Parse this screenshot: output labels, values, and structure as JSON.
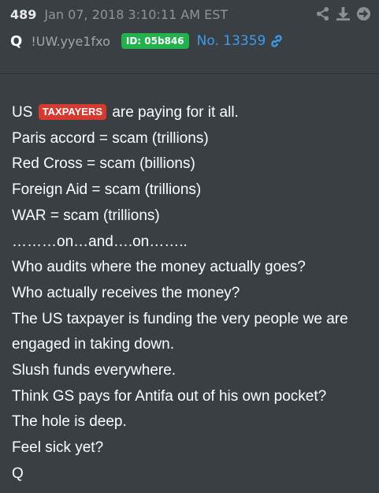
{
  "header": {
    "post_number": "489",
    "timestamp": "Jan 07, 2018 3:10:11 AM EST",
    "author": "Q",
    "tripcode": "!UW.yye1fxo",
    "id_badge": "ID: 05b846",
    "post_ref": "No. 13359",
    "icons": [
      "share-icon",
      "download-icon",
      "arrow-right-circle-icon",
      "link-icon"
    ],
    "id_badge_color": "#22b14c",
    "post_ref_color": "#3f9bea"
  },
  "body": {
    "line1_prefix": "US",
    "tag": "TAXPAYERS",
    "tag_color": "#d63a2f",
    "line1_suffix": "are paying for it all.",
    "lines": [
      "Paris accord = scam (trillions)",
      "Red Cross = scam (billions)",
      "Foreign Aid = scam (trillions)",
      "WAR = scam (trillions)",
      "………on…and….on……..",
      "Who audits where the money actually goes?",
      "Who actually receives the money?",
      "The US taxpayer is funding the very people we are",
      "engaged in taking down.",
      "Slush funds everywhere.",
      "Think GS pays for Antifa out of his own pocket?",
      "The hole is deep.",
      "Feel sick yet?",
      "Q"
    ]
  }
}
